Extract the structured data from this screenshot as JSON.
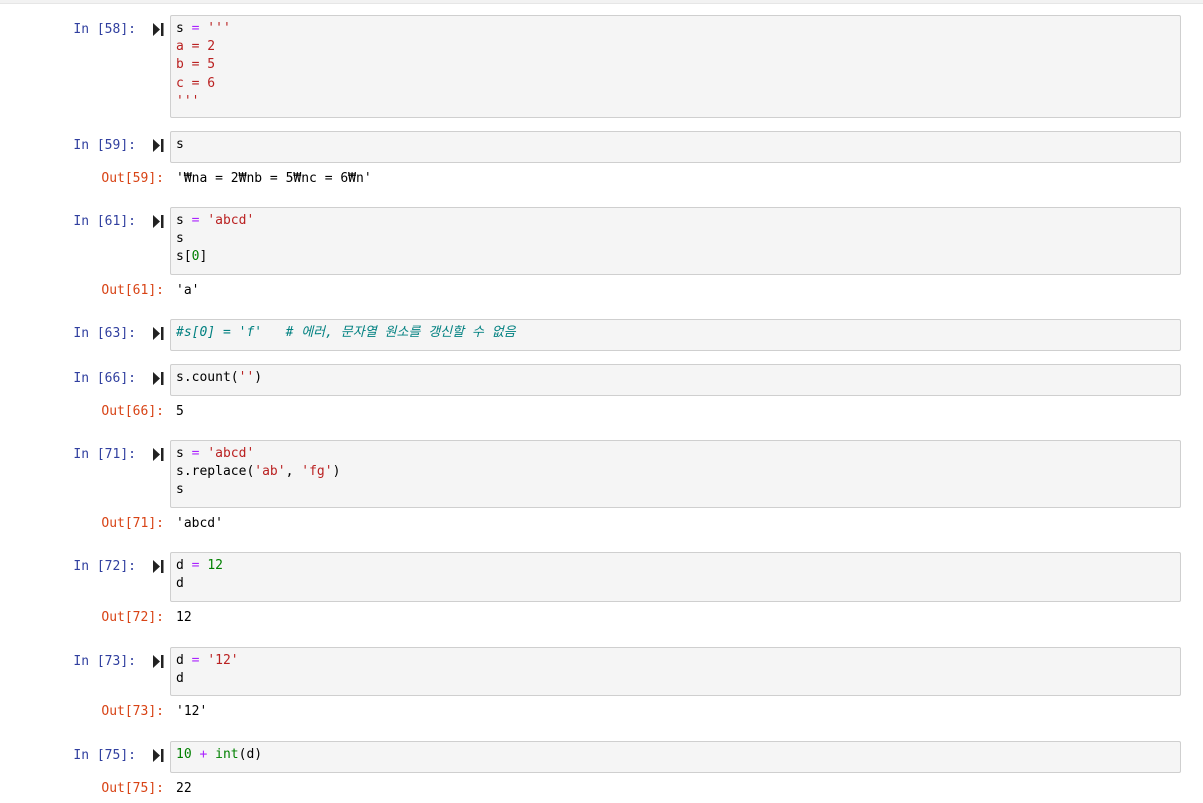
{
  "cells": [
    {
      "in_prompt": "In [58]:",
      "lines": [
        [
          {
            "t": "s ",
            "c": ""
          },
          {
            "t": "=",
            "c": "kw-op"
          },
          {
            "t": " '''",
            "c": "str"
          }
        ],
        [
          {
            "t": "a = 2",
            "c": "str"
          }
        ],
        [
          {
            "t": "b = 5",
            "c": "str"
          }
        ],
        [
          {
            "t": "c = 6",
            "c": "str"
          }
        ],
        [
          {
            "t": "'''",
            "c": "str"
          }
        ]
      ]
    },
    {
      "in_prompt": "In [59]:",
      "lines": [
        [
          {
            "t": "s",
            "c": ""
          }
        ]
      ],
      "out_prompt": "Out[59]:",
      "output": "'₩na = 2₩nb = 5₩nc = 6₩n'"
    },
    {
      "in_prompt": "In [61]:",
      "lines": [
        [
          {
            "t": "s ",
            "c": ""
          },
          {
            "t": "=",
            "c": "kw-op"
          },
          {
            "t": " ",
            "c": ""
          },
          {
            "t": "'abcd'",
            "c": "str"
          }
        ],
        [
          {
            "t": "s",
            "c": ""
          }
        ],
        [
          {
            "t": "s[",
            "c": ""
          },
          {
            "t": "0",
            "c": "num"
          },
          {
            "t": "]",
            "c": ""
          }
        ]
      ],
      "out_prompt": "Out[61]:",
      "output": "'a'"
    },
    {
      "in_prompt": "In [63]:",
      "lines": [
        [
          {
            "t": "#s[0] = 'f'   # 에러, 문자열 원소를 갱신할 수 없음",
            "c": "cm"
          }
        ]
      ]
    },
    {
      "in_prompt": "In [66]:",
      "lines": [
        [
          {
            "t": "s.count(",
            "c": ""
          },
          {
            "t": "''",
            "c": "str"
          },
          {
            "t": ")",
            "c": ""
          }
        ]
      ],
      "out_prompt": "Out[66]:",
      "output": "5"
    },
    {
      "in_prompt": "In [71]:",
      "lines": [
        [
          {
            "t": "s ",
            "c": ""
          },
          {
            "t": "=",
            "c": "kw-op"
          },
          {
            "t": " ",
            "c": ""
          },
          {
            "t": "'abcd'",
            "c": "str"
          }
        ],
        [
          {
            "t": "s.replace(",
            "c": ""
          },
          {
            "t": "'ab'",
            "c": "str"
          },
          {
            "t": ", ",
            "c": ""
          },
          {
            "t": "'fg'",
            "c": "str"
          },
          {
            "t": ")",
            "c": ""
          }
        ],
        [
          {
            "t": "s",
            "c": ""
          }
        ]
      ],
      "out_prompt": "Out[71]:",
      "output": "'abcd'"
    },
    {
      "in_prompt": "In [72]:",
      "lines": [
        [
          {
            "t": "d ",
            "c": ""
          },
          {
            "t": "=",
            "c": "kw-op"
          },
          {
            "t": " ",
            "c": ""
          },
          {
            "t": "12",
            "c": "num"
          }
        ],
        [
          {
            "t": "d",
            "c": ""
          }
        ]
      ],
      "out_prompt": "Out[72]:",
      "output": "12"
    },
    {
      "in_prompt": "In [73]:",
      "lines": [
        [
          {
            "t": "d ",
            "c": ""
          },
          {
            "t": "=",
            "c": "kw-op"
          },
          {
            "t": " ",
            "c": ""
          },
          {
            "t": "'12'",
            "c": "str"
          }
        ],
        [
          {
            "t": "d",
            "c": ""
          }
        ]
      ],
      "out_prompt": "Out[73]:",
      "output": "'12'"
    },
    {
      "in_prompt": "In [75]:",
      "lines": [
        [
          {
            "t": "10",
            "c": "num"
          },
          {
            "t": " ",
            "c": ""
          },
          {
            "t": "+",
            "c": "kw-op"
          },
          {
            "t": " ",
            "c": ""
          },
          {
            "t": "int",
            "c": "fn"
          },
          {
            "t": "(d)",
            "c": ""
          }
        ]
      ],
      "out_prompt": "Out[75]:",
      "output": "22"
    }
  ],
  "icons": {
    "run": "run-cell-icon"
  },
  "colors": {
    "in_prompt": "#303f9f",
    "out_prompt": "#d84315",
    "input_bg": "#f5f5f5",
    "input_border": "#cfcfcf",
    "string": "#ba2121",
    "number": "#008000",
    "operator": "#aa22ff",
    "comment": "#008080"
  }
}
